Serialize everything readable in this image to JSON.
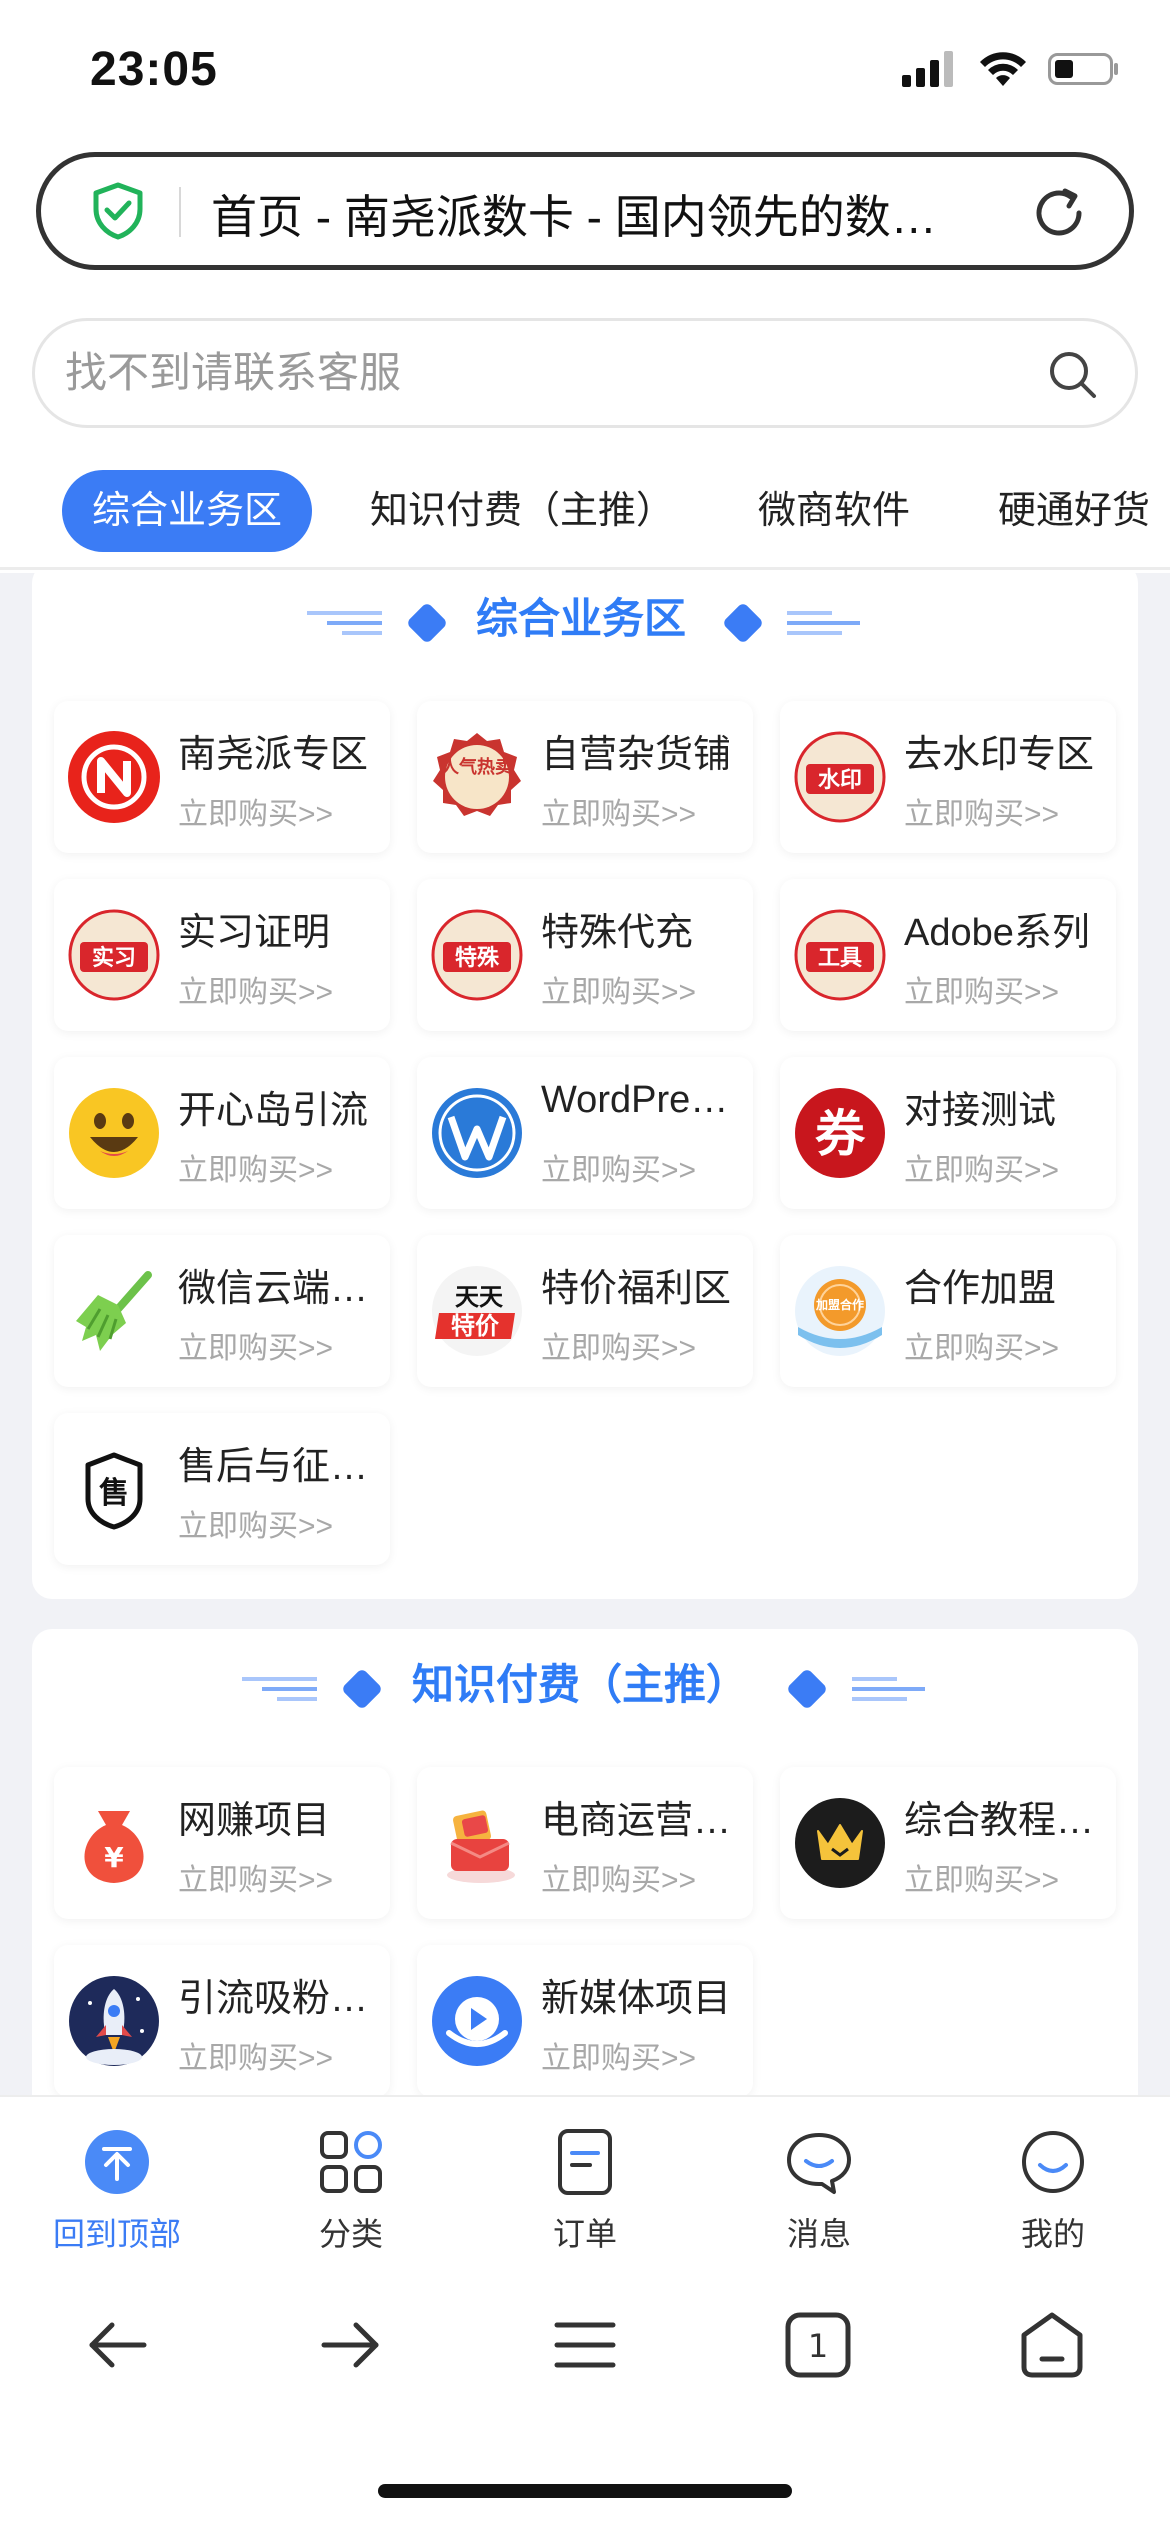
{
  "status_bar": {
    "time": "23:05"
  },
  "url_bar": {
    "title": "首页 - 南尧派数卡 - 国内领先的数…"
  },
  "search": {
    "placeholder": "找不到请联系客服"
  },
  "tabs": [
    {
      "label": "综合业务区"
    },
    {
      "label": "知识付费（主推）"
    },
    {
      "label": "微商软件"
    },
    {
      "label": "硬通好货"
    }
  ],
  "sections": [
    {
      "title": "综合业务区",
      "items": [
        {
          "name": "南尧派专区",
          "sub": "立即购买>>",
          "icon": "n-logo-icon"
        },
        {
          "name": "自营杂货铺",
          "sub": "立即购买>>",
          "icon": "hot-sale-badge-icon",
          "badge_text": "人气热卖"
        },
        {
          "name": "去水印专区",
          "sub": "立即购买>>",
          "icon": "watermark-badge-icon",
          "badge_text": "水印"
        },
        {
          "name": "实习证明",
          "sub": "立即购买>>",
          "icon": "internship-badge-icon",
          "badge_text": "实习"
        },
        {
          "name": "特殊代充",
          "sub": "立即购买>>",
          "icon": "special-badge-icon",
          "badge_text": "特殊"
        },
        {
          "name": "Adobe系列",
          "sub": "立即购买>>",
          "icon": "tools-badge-icon",
          "badge_text": "工具"
        },
        {
          "name": "开心岛引流",
          "sub": "立即购买>>",
          "icon": "smiley-icon"
        },
        {
          "name": "WordPres…",
          "sub": "立即购买>>",
          "icon": "wordpress-icon"
        },
        {
          "name": "对接测试",
          "sub": "立即购买>>",
          "icon": "coupon-icon",
          "badge_text": "券"
        },
        {
          "name": "微信云端…",
          "sub": "立即购买>>",
          "icon": "broom-icon"
        },
        {
          "name": "特价福利区",
          "sub": "立即购买>>",
          "icon": "daily-discount-icon",
          "badge_text": "天天",
          "badge_text2": "特价"
        },
        {
          "name": "合作加盟",
          "sub": "立即购买>>",
          "icon": "join-cooperation-icon",
          "badge_text": "加盟合作"
        },
        {
          "name": "售后与征…",
          "sub": "立即购买>>",
          "icon": "after-sales-shield-icon",
          "badge_text": "售"
        }
      ]
    },
    {
      "title": "知识付费（主推）",
      "items": [
        {
          "name": "网赚项目",
          "sub": "立即购买>>",
          "icon": "money-bag-icon",
          "badge_text": "¥"
        },
        {
          "name": "电商运营…",
          "sub": "立即购买>>",
          "icon": "red-envelope-icon"
        },
        {
          "name": "综合教程…",
          "sub": "立即购买>>",
          "icon": "crown-icon"
        },
        {
          "name": "引流吸粉…",
          "sub": "立即购买>>",
          "icon": "rocket-icon"
        },
        {
          "name": "新媒体项目",
          "sub": "立即购买>>",
          "icon": "video-play-icon"
        }
      ]
    }
  ],
  "bottom_nav": [
    {
      "label": "回到顶部",
      "icon": "back-to-top-icon",
      "active": true
    },
    {
      "label": "分类",
      "icon": "category-grid-icon"
    },
    {
      "label": "订单",
      "icon": "order-icon"
    },
    {
      "label": "消息",
      "icon": "message-icon"
    },
    {
      "label": "我的",
      "icon": "profile-icon"
    }
  ],
  "browser_bar": {
    "tab_count": "1"
  },
  "colors": {
    "accent": "#3b7cf5",
    "badge_red": "#d9262c",
    "page_bg": "#f1f2f6"
  }
}
